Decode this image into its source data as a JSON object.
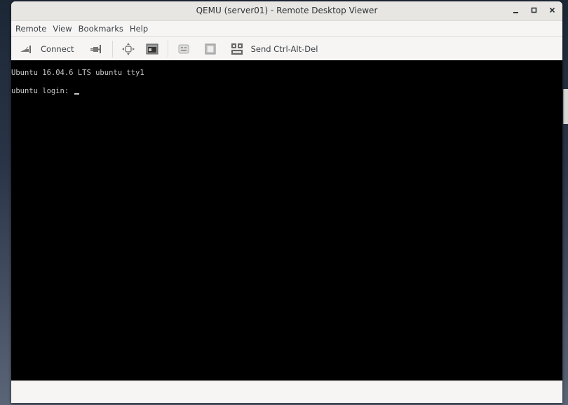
{
  "window": {
    "title": "QEMU (server01) - Remote Desktop Viewer",
    "controls": [
      "minimize",
      "maximize",
      "close"
    ]
  },
  "menubar": {
    "items": [
      {
        "label": "Remote"
      },
      {
        "label": "View"
      },
      {
        "label": "Bookmarks"
      },
      {
        "label": "Help"
      }
    ]
  },
  "toolbar": {
    "connect_label": "Connect",
    "send_cad_label": "Send Ctrl-Alt-Del",
    "icons": [
      "connect-icon",
      "disconnect-icon",
      "fullscreen-icon",
      "screenshot-icon",
      "keyboard-grab-icon",
      "scaling-icon",
      "send-keys-icon"
    ]
  },
  "console": {
    "line1": "Ubuntu 16.04.6 LTS ubuntu tty1",
    "line2": "ubuntu login: "
  },
  "colors": {
    "screen_bg": "#000000",
    "console_text": "#c8c8c8",
    "chrome_bg": "#f6f5f4"
  }
}
